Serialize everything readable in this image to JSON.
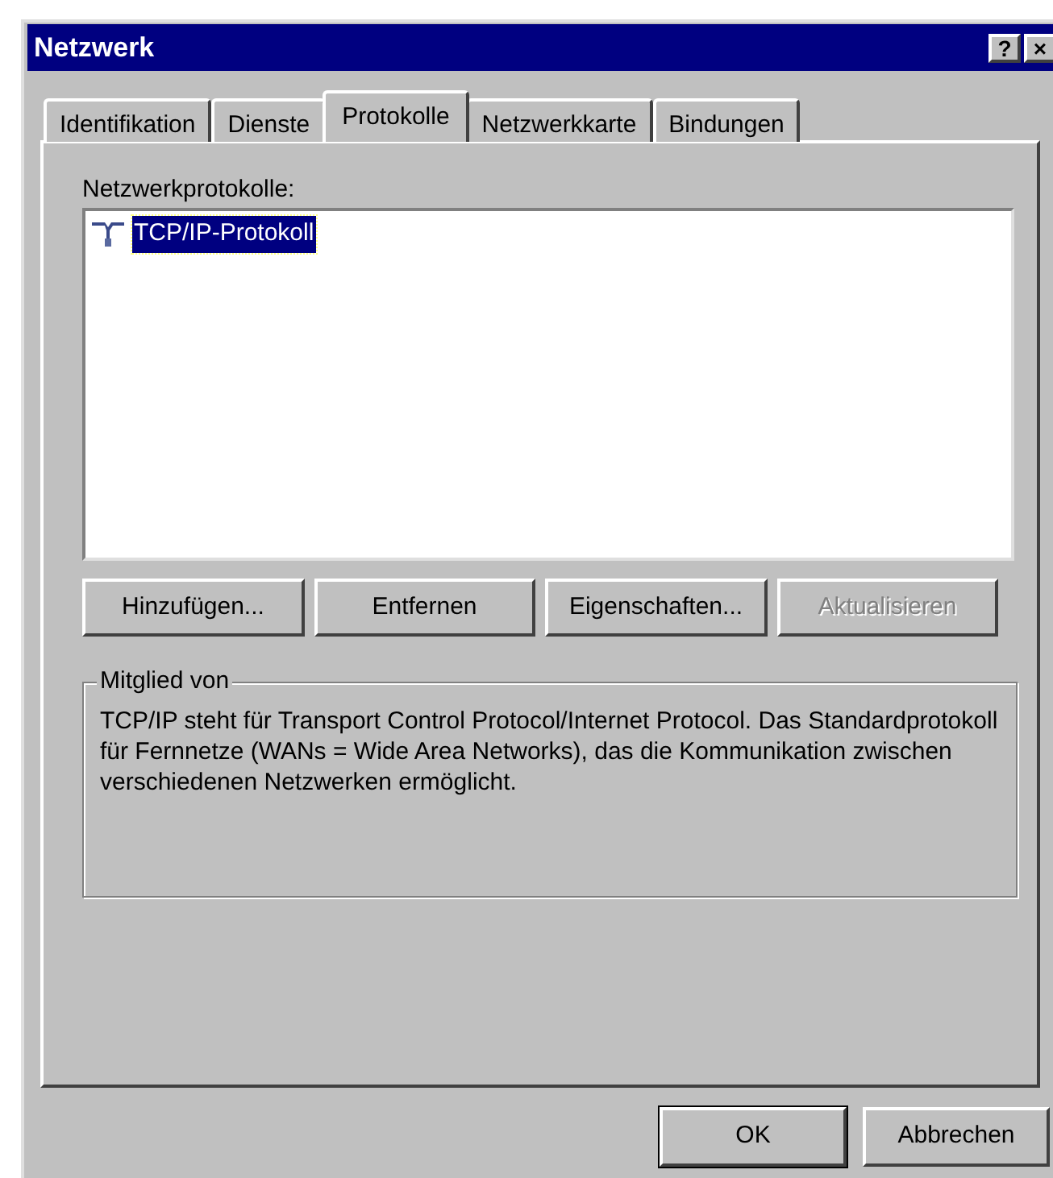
{
  "window": {
    "title": "Netzwerk",
    "title_buttons": [
      "?",
      "×"
    ]
  },
  "tabs": [
    {
      "label": "Identifikation",
      "selected": false
    },
    {
      "label": "Dienste",
      "selected": false
    },
    {
      "label": "Protokolle",
      "selected": true
    },
    {
      "label": "Netzwerkkarte",
      "selected": false
    },
    {
      "label": "Bindungen",
      "selected": false
    }
  ],
  "list_label": "Netzwerkprotokolle:",
  "list_items": [
    {
      "label": "TCP/IP-Protokoll",
      "selected": true
    }
  ],
  "buttons": [
    {
      "label": "Hinzufügen...",
      "disabled": false
    },
    {
      "label": "Entfernen",
      "disabled": false
    },
    {
      "label": "Eigenschaften...",
      "disabled": false
    },
    {
      "label": "Aktualisieren",
      "disabled": true
    }
  ],
  "group": {
    "title": "Mitglied von",
    "text": "TCP/IP steht für Transport Control Protocol/Internet Protocol. Das Standardprotokoll für Fernnetze (WANs = Wide Area Networks), das die Kommunikation zwischen verschiedenen Netzwerken ermöglicht."
  },
  "dialog_buttons": [
    {
      "label": "OK",
      "default": true
    },
    {
      "label": "Abbrechen",
      "default": false
    }
  ]
}
